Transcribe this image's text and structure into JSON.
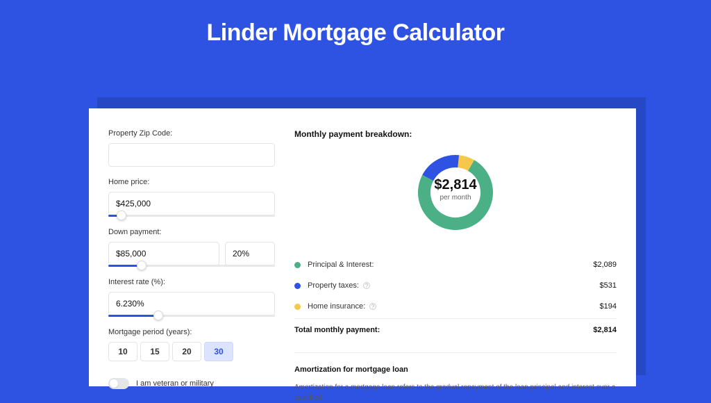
{
  "title": "Linder Mortgage Calculator",
  "form": {
    "zip_label": "Property Zip Code:",
    "zip_value": "",
    "price_label": "Home price:",
    "price_value": "$425,000",
    "price_slider_pct": 8,
    "down_label": "Down payment:",
    "down_value": "$85,000",
    "down_pct_value": "20%",
    "down_slider_pct": 20,
    "rate_label": "Interest rate (%):",
    "rate_value": "6.230%",
    "rate_slider_pct": 30,
    "period_label": "Mortgage period (years):",
    "periods": [
      "10",
      "15",
      "20",
      "30"
    ],
    "period_active": "30",
    "veteran_label": "I am veteran or military",
    "veteran_on": false
  },
  "breakdown": {
    "title": "Monthly payment breakdown:",
    "center_value": "$2,814",
    "center_sub": "per month",
    "items": [
      {
        "label": "Principal & Interest:",
        "value": "$2,089",
        "color": "#4bb085",
        "has_info": false
      },
      {
        "label": "Property taxes:",
        "value": "$531",
        "color": "#2e53e3",
        "has_info": true
      },
      {
        "label": "Home insurance:",
        "value": "$194",
        "color": "#f5c84c",
        "has_info": true
      }
    ],
    "total_label": "Total monthly payment:",
    "total_value": "$2,814"
  },
  "chart_data": {
    "type": "pie",
    "title": "Monthly payment breakdown",
    "categories": [
      "Principal & Interest",
      "Property taxes",
      "Home insurance"
    ],
    "values": [
      2089,
      531,
      194
    ],
    "colors": [
      "#4bb085",
      "#2e53e3",
      "#f5c84c"
    ],
    "center_label": "$2,814 per month"
  },
  "amort": {
    "title": "Amortization for mortgage loan",
    "text": "Amortization for a mortgage loan refers to the gradual repayment of the loan principal and interest over a specified"
  }
}
